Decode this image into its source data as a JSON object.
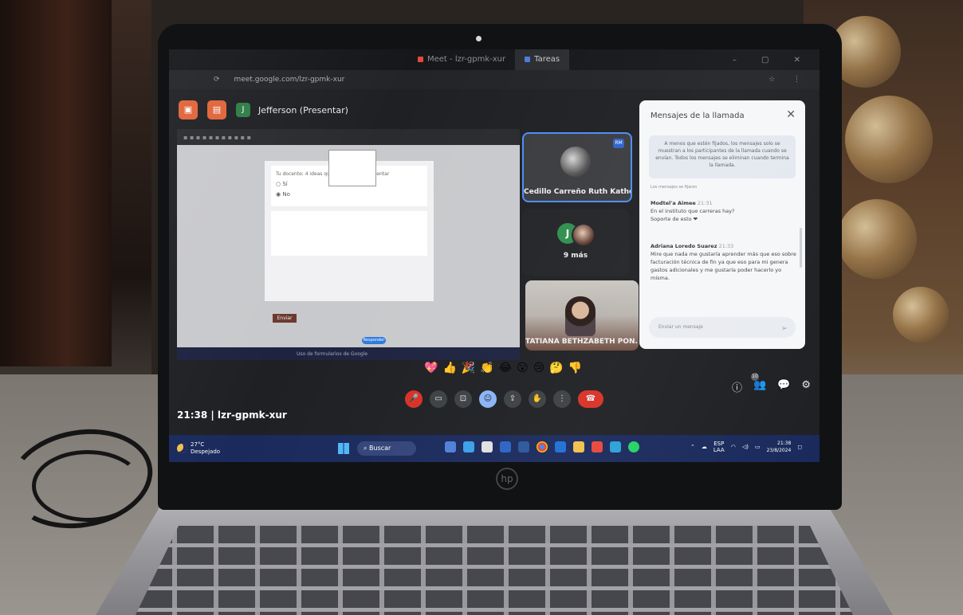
{
  "browser": {
    "tabs": [
      {
        "label": "Meet - lzr-gpmk-xur",
        "color": "#e24a3b",
        "active": true
      },
      {
        "label": "Tareas",
        "color": "#4a7bd9",
        "active": false
      }
    ],
    "url": "meet.google.com/lzr-gpmk-xur",
    "window_controls": "– ▢ ✕"
  },
  "meet": {
    "presenter": {
      "initial": "J",
      "label": "Jefferson (Presentar)"
    },
    "presentation": {
      "question_text": "Tu docente: 4 ideas que se destacan, comentar",
      "option_si": "Sí",
      "option_no": "No",
      "button_label": "Enviar",
      "bottom_text": "Uso de formularios de Google",
      "blue_pill": "Responder"
    },
    "tiles": [
      {
        "name": "Cedillo Carreño Ruth Katheri...",
        "badge": "RM"
      },
      {
        "initial": "J",
        "more_label": "9 más"
      },
      {
        "name": "TATIANA BETHZABETH PON..."
      }
    ],
    "reactions": [
      "💖",
      "👍",
      "🎉",
      "👏",
      "😂",
      "😮",
      "😢",
      "🤔",
      "👎"
    ],
    "controls": {
      "mic": "🎤",
      "camera": "▭",
      "captions": "⊡",
      "emoji": "☺",
      "present": "⇪",
      "raise_hand": "✋",
      "more": "⋮",
      "end": "☎"
    },
    "right_controls": {
      "info": "ⓘ",
      "people": "👥",
      "people_count": "10",
      "chat": "💬",
      "activities": "⚙"
    },
    "meeting_info": "21:38 | lzr-gpmk-xur"
  },
  "chat": {
    "title": "Mensajes de la llamada",
    "notice": "A menos que estén fijados, los mensajes solo se muestran a los participantes de la llamada cuando se envían. Todos los mensajes se eliminan cuando termina la llamada.",
    "subtitle": "Los mensajes se fijaron",
    "messages": [
      {
        "author": "Modtel'a Aimee",
        "time": "21:31",
        "lines": [
          "En el instituto que carreras hay?",
          "Soporte de esto ❤"
        ]
      },
      {
        "author": "Adriana Loredo Suarez",
        "time": "21:33",
        "lines": [
          "Mire que nada me gustaría aprender más que eso sobre facturación técnica de fin ya que eso para mi genera gastos adicionales y me gustaría poder hacerlo yo misma."
        ]
      }
    ],
    "input_placeholder": "Enviar un mensaje",
    "send_icon": "➢"
  },
  "taskbar": {
    "temperature": "27°C",
    "weather": "Despejado",
    "search_label": "Buscar",
    "language": "ESP",
    "language_sub": "LAA",
    "time": "21:38",
    "date": "23/8/2024"
  },
  "colors": {
    "accent_orange": "#e0643a",
    "tile_border": "#4b8df8",
    "end_call_red": "#d93025",
    "taskbar_blue": "#1a2a5c"
  }
}
